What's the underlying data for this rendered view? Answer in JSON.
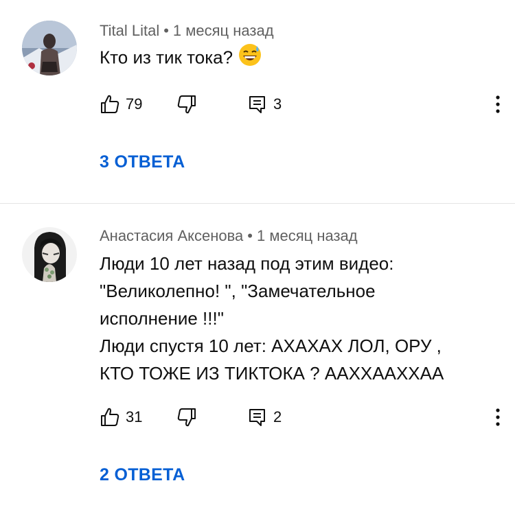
{
  "comments": [
    {
      "author": "Tital Lital",
      "separator": "•",
      "time": "1 месяц назад",
      "text_lines": [
        "Кто из тик тока?"
      ],
      "emoji": "grinning-sweat-emoji",
      "likes": "79",
      "replies_count": "3",
      "replies_label": "3 ОТВЕТА"
    },
    {
      "author": "Анастасия Аксенова",
      "separator": "•",
      "time": "1 месяц назад",
      "text_lines": [
        "Люди 10 лет назад под этим видео:",
        "\"Великолепно! \", \"Замечательное",
        "исполнение !!!\"",
        "Люди спустя 10 лет: АХАХАХ ЛОЛ, ОРУ ,",
        "КТО ТОЖЕ ИЗ ТИКТОКА ? ААХХААХХАА"
      ],
      "likes": "31",
      "replies_count": "2",
      "replies_label": "2 ОТВЕТА"
    }
  ],
  "colors": {
    "link": "#065fd4",
    "meta": "#606060",
    "text": "#0f0f0f",
    "divider": "#e5e5e5"
  },
  "icons": [
    "thumb-up-icon",
    "thumb-down-icon",
    "reply-comment-icon",
    "more-vert-icon"
  ]
}
